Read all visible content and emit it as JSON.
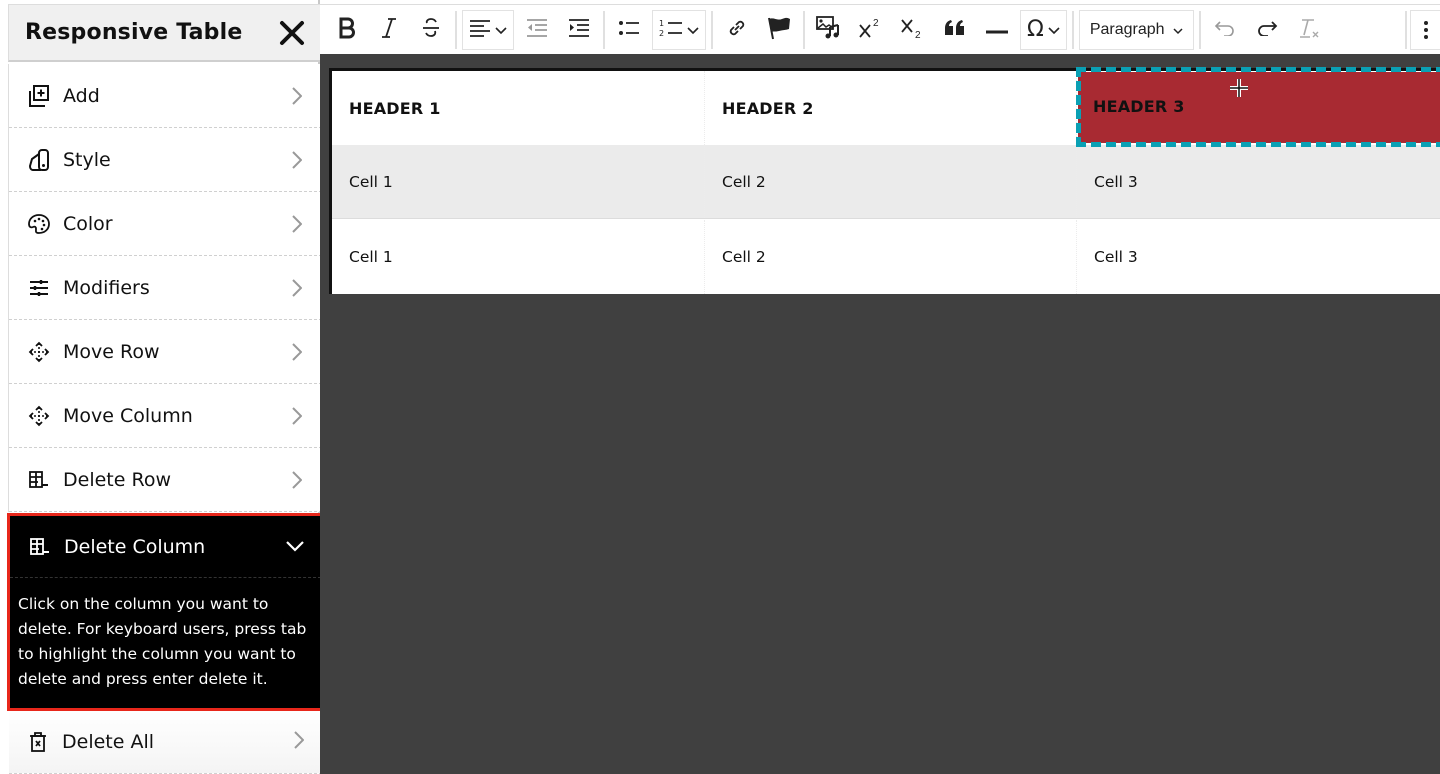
{
  "sidebar": {
    "title": "Responsive Table",
    "close_icon": "close-icon",
    "items": [
      {
        "label": "Add",
        "icon": "add-layer-icon"
      },
      {
        "label": "Style",
        "icon": "swatch-icon"
      },
      {
        "label": "Color",
        "icon": "palette-icon"
      },
      {
        "label": "Modifiers",
        "icon": "sliders-icon"
      },
      {
        "label": "Move Row",
        "icon": "move-icon"
      },
      {
        "label": "Move Column",
        "icon": "move-icon"
      },
      {
        "label": "Delete Row",
        "icon": "delete-row-icon"
      }
    ],
    "expanded": {
      "label": "Delete Column",
      "icon": "delete-column-icon",
      "description": "Click on the column you want to delete. For keyboard users, press tab to highlight the column you want to delete and press enter delete it."
    },
    "last_item": {
      "label": "Delete All",
      "icon": "trash-icon"
    },
    "colors": {
      "expanded_bg": "#000000",
      "expanded_border": "#e8271b"
    }
  },
  "toolbar": {
    "buttons": [
      "bold",
      "italic",
      "strikethrough",
      "align",
      "outdent",
      "indent",
      "bulleted-list",
      "numbered-list",
      "link",
      "flag",
      "media",
      "superscript",
      "subscript",
      "blockquote",
      "horizontal-line",
      "special-characters",
      "undo",
      "redo",
      "clear-formatting",
      "more"
    ],
    "paragraph_label": "Paragraph"
  },
  "table": {
    "headers": [
      "HEADER 1",
      "HEADER 2",
      "HEADER 3"
    ],
    "rows": [
      [
        "Cell 1",
        "Cell 2",
        "Cell 3"
      ],
      [
        "Cell 1",
        "Cell 2",
        "Cell 3"
      ]
    ],
    "highlighted_column_index": 2,
    "colors": {
      "highlight_fill": "#a82a32",
      "highlight_border": "#0aa0b4",
      "canvas_bg": "#404040"
    }
  }
}
